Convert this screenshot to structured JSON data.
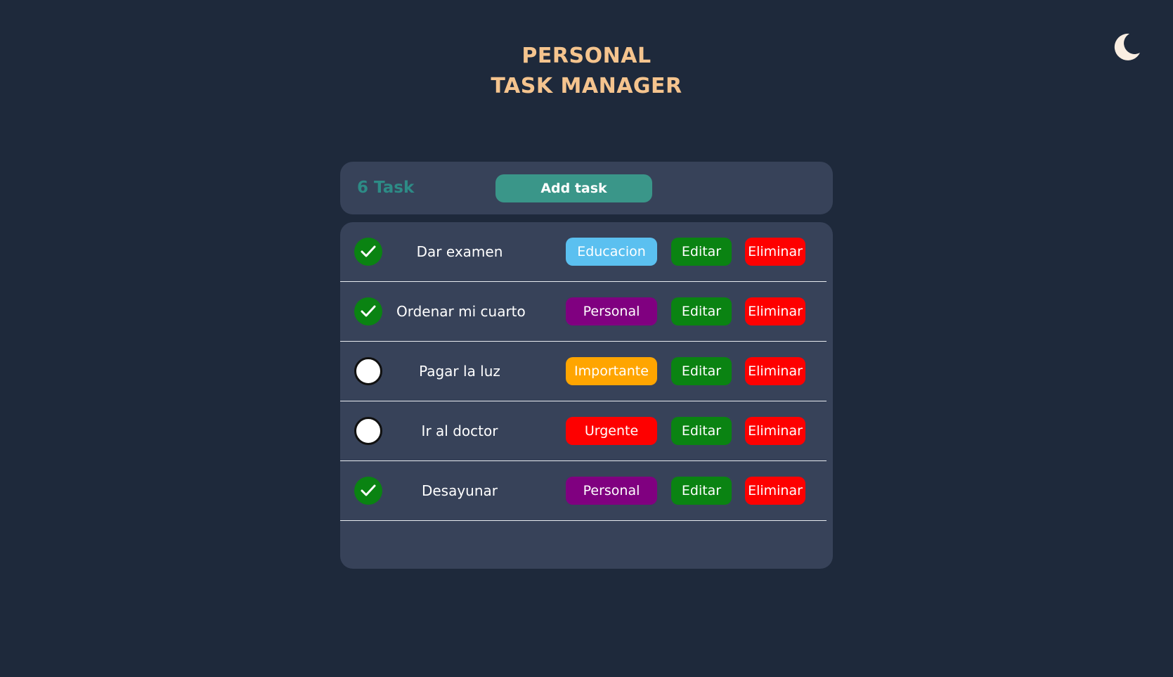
{
  "app": {
    "title_line1": "PERSONAL",
    "title_line2": "TASK MANAGER",
    "theme_icon": "moon-icon"
  },
  "toolbar": {
    "task_count": "6 Task",
    "add_label": "Add task"
  },
  "colors": {
    "background": "#1e293b",
    "card": "#374259",
    "title": "#f5c48e",
    "task_count": "#2d8b86",
    "add_button": "#3a9689",
    "edit_button": "#0a8312",
    "delete_button": "#fe0000",
    "done_check": "#0a8312"
  },
  "tasks": [
    {
      "name": "Dar examen",
      "done": true,
      "category": "Educacion",
      "category_color": "#5bc0f0",
      "edit_label": "Editar",
      "delete_label": "Eliminar"
    },
    {
      "name": "Ordenar mi cuarto",
      "done": true,
      "category": "Personal",
      "category_color": "#800080",
      "edit_label": "Editar",
      "delete_label": "Eliminar"
    },
    {
      "name": "Pagar la luz",
      "done": false,
      "category": "Importante",
      "category_color": "#ffa500",
      "edit_label": "Editar",
      "delete_label": "Eliminar"
    },
    {
      "name": "Ir al doctor",
      "done": false,
      "category": "Urgente",
      "category_color": "#fe0000",
      "edit_label": "Editar",
      "delete_label": "Eliminar"
    },
    {
      "name": "Desayunar",
      "done": true,
      "category": "Personal",
      "category_color": "#800080",
      "edit_label": "Editar",
      "delete_label": "Eliminar"
    }
  ]
}
